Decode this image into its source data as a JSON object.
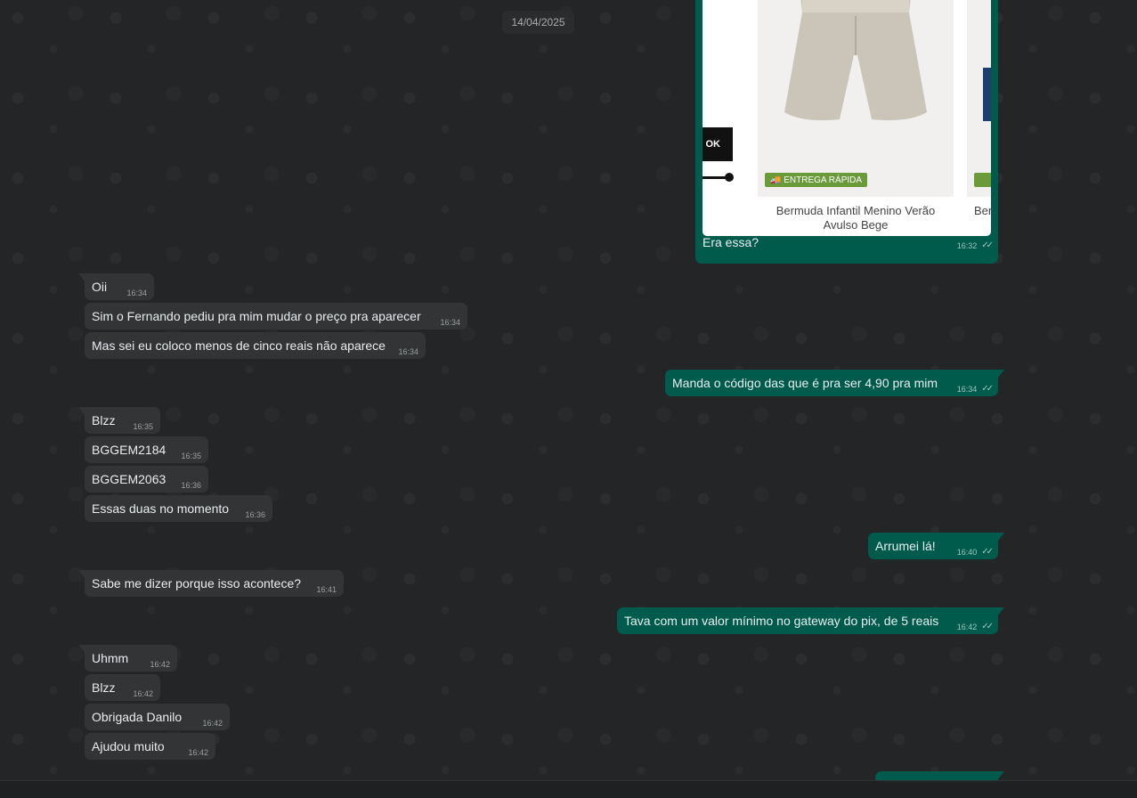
{
  "date_chip": "14/04/2025",
  "image_message": {
    "promo_label": "OK",
    "badge": "ENTREGA RÁPIDA",
    "product_title": "Bermuda Infantil Menino Verão Avulso Bege",
    "product_title_2": "Ber",
    "caption": "Era essa?",
    "time": "16:32",
    "ticks": "✓✓"
  },
  "messages": [
    {
      "text": "Oii",
      "time": "16:34",
      "ticks": ""
    },
    {
      "text": "Sim o Fernando pediu pra mim mudar o preço pra aparecer",
      "time": "16:34",
      "ticks": ""
    },
    {
      "text": "Mas sei eu coloco menos de cinco reais não aparece",
      "time": "16:34",
      "ticks": ""
    },
    {
      "text": "Manda o código das que é pra ser 4,90 pra mim",
      "time": "16:34",
      "ticks": "✓✓"
    },
    {
      "text": "Blzz",
      "time": "16:35",
      "ticks": ""
    },
    {
      "text": "BGGEM2184",
      "time": "16:35",
      "ticks": ""
    },
    {
      "text": "BGGEM2063",
      "time": "16:36",
      "ticks": ""
    },
    {
      "text": "Essas duas no momento",
      "time": "16:36",
      "ticks": ""
    },
    {
      "text": "Arrumei lá!",
      "time": "16:40",
      "ticks": "✓✓"
    },
    {
      "text": "Sabe me dizer porque isso acontece?",
      "time": "16:41",
      "ticks": ""
    },
    {
      "text": "Tava com um valor mínimo no gateway do pix, de 5 reais",
      "time": "16:42",
      "ticks": "✓✓"
    },
    {
      "text": "Uhmm",
      "time": "16:42",
      "ticks": ""
    },
    {
      "text": "Blzz",
      "time": "16:42",
      "ticks": ""
    },
    {
      "text": "Obrigada Danilo",
      "time": "16:42",
      "ticks": ""
    },
    {
      "text": "Ajudou muito",
      "time": "16:42",
      "ticks": ""
    }
  ],
  "colors": {
    "incoming_bubble": "#323436",
    "outgoing_bubble": "#005b4d",
    "chat_background": "#242526",
    "badge_green": "#6a9a3a"
  }
}
